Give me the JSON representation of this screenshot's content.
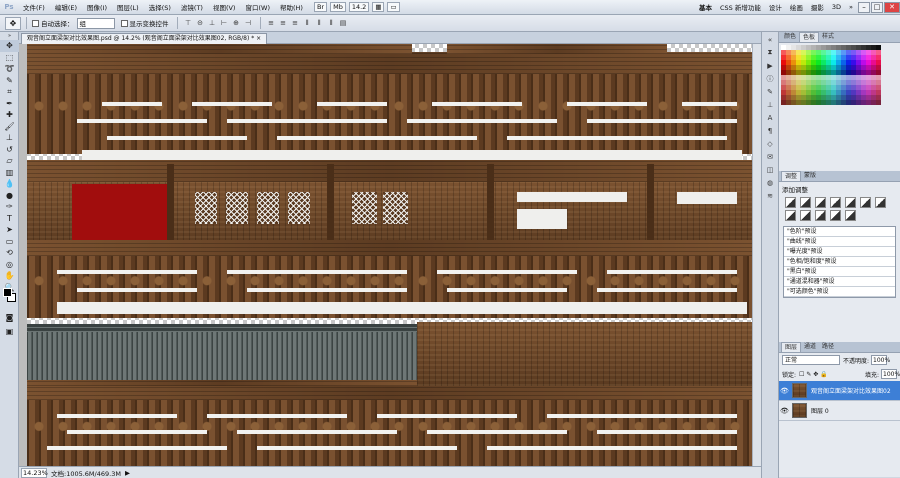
{
  "app": {
    "logo": "Ps"
  },
  "menu": {
    "items": [
      "文件(F)",
      "编辑(E)",
      "图像(I)",
      "图层(L)",
      "选择(S)",
      "滤镜(T)",
      "视图(V)",
      "窗口(W)",
      "帮助(H)"
    ]
  },
  "menu_tools": {
    "zoom": "14.2"
  },
  "workspace": {
    "items": [
      "基本",
      "CSS 新增功能",
      "设计",
      "绘画",
      "摄影",
      "3D"
    ],
    "more": "»"
  },
  "window_buttons": {
    "minimize": "–",
    "restore": "□",
    "close": "✕"
  },
  "options": {
    "auto_select_label": "自动选择：",
    "auto_select_value": "组",
    "show_transform_label": "显示变换控件"
  },
  "document": {
    "tab_title": "观音阁立面梁架对比效果图.psd @ 14.2% (观音阁立面梁架对比效果图02, RGB/8) *",
    "close": "×"
  },
  "status": {
    "zoom": "14.23%",
    "doc_info": "文档:1005.6M/469.3M"
  },
  "panels": {
    "swatch_tabs": [
      "颜色",
      "色板",
      "样式"
    ],
    "adjust_title": "添加调整",
    "presets": [
      "\"色阶\"预设",
      "\"曲线\"预设",
      "\"曝光度\"预设",
      "\"色相/饱和度\"预设",
      "\"黑白\"预设",
      "\"通道混和器\"预设",
      "\"可选颜色\"预设"
    ],
    "layer_tabs": [
      "图层",
      "通道",
      "路径"
    ],
    "blend_mode": "正常",
    "opacity_label": "不透明度:",
    "opacity_value": "100%",
    "lock_label": "锁定:",
    "fill_label": "填充:",
    "fill_value": "100%",
    "layers": [
      {
        "name": "观音阁立面梁架对比效果图02",
        "selected": true
      },
      {
        "name": "图层 0",
        "selected": false
      }
    ]
  }
}
